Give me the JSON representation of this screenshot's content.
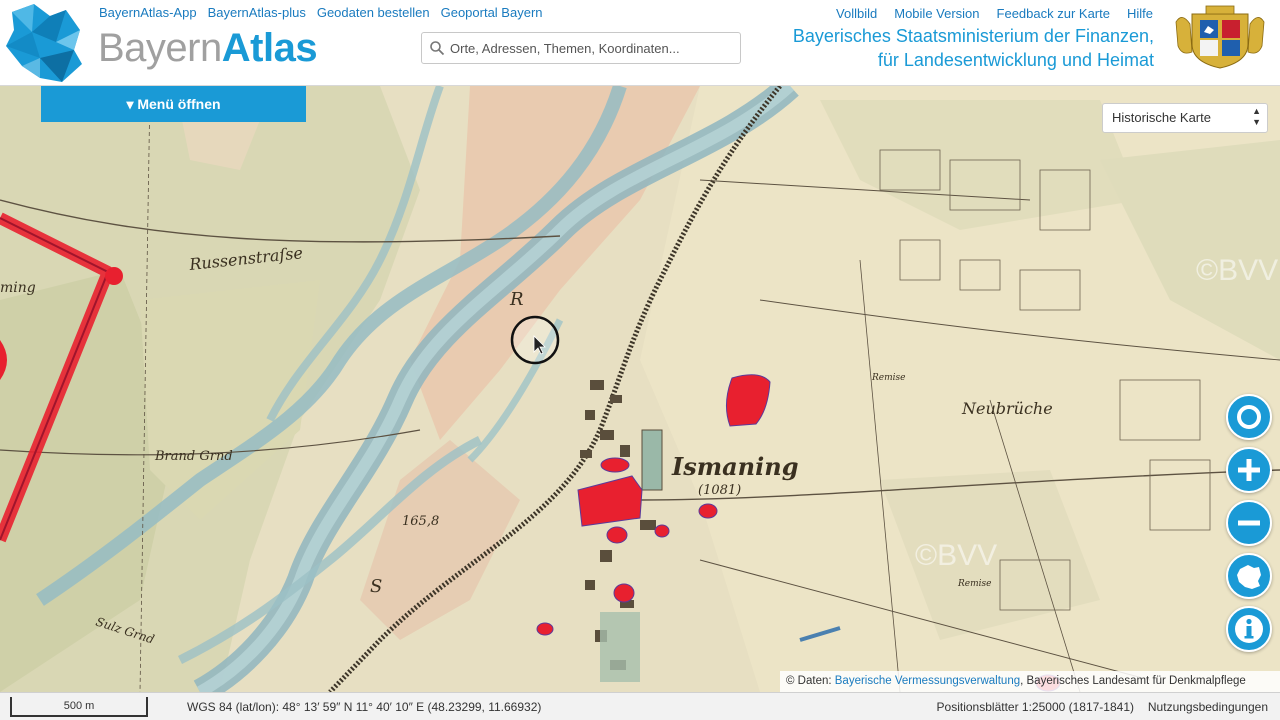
{
  "header": {
    "logo": {
      "part1": "Bayern",
      "part2": "Atlas"
    },
    "links_left": [
      "BayernAtlas-App",
      "BayernAtlas-plus",
      "Geodaten bestellen",
      "Geoportal Bayern"
    ],
    "links_right": [
      "Vollbild",
      "Mobile Version",
      "Feedback zur Karte",
      "Hilfe"
    ],
    "search": {
      "placeholder": "Orte, Adressen, Themen, Koordinaten..."
    },
    "ministry_line1": "Bayerisches Staatsministerium der Finanzen,",
    "ministry_line2": "für Landesentwicklung und Heimat"
  },
  "menu": {
    "label": "▾ Menü öffnen"
  },
  "map": {
    "layer_select": "Historische Karte",
    "labels": {
      "ismaning": "Ismaning",
      "ismaning_num": "(1081)",
      "russenstrasse": "Russenstraſse",
      "brand": "Brand Grnd",
      "sulz": "Sulz Grnd",
      "neubruche": "Neubrüche",
      "remise1": "Remise",
      "remise2": "Remise",
      "elev": "165,8",
      "ing": "ming",
      "river_r": "R",
      "river_s": "S",
      "copyright1": "©BVV",
      "copyright2": "©BVV"
    },
    "controls": [
      "locate-icon",
      "zoom-in-icon",
      "zoom-out-icon",
      "bavaria-icon",
      "info-icon"
    ]
  },
  "attribution": {
    "prefix": "©  Daten: ",
    "link": "Bayerische Vermessungsverwaltung",
    "suffix": ", Bayerisches Landesamt für Denkmalpflege"
  },
  "footer": {
    "scale": "500 m",
    "coords": "WGS 84 (lat/lon): 48° 13′ 59″ N 11° 40′ 10″ E (48.23299, 11.66932)",
    "sheets": "Positionsblätter 1:25000 (1817-1841)",
    "terms": "Nutzungsbedingungen"
  },
  "colors": {
    "accent": "#1a9ad6",
    "monument": "#e8202f",
    "paper": "#e9e1c4",
    "river": "#8fb9c4"
  }
}
